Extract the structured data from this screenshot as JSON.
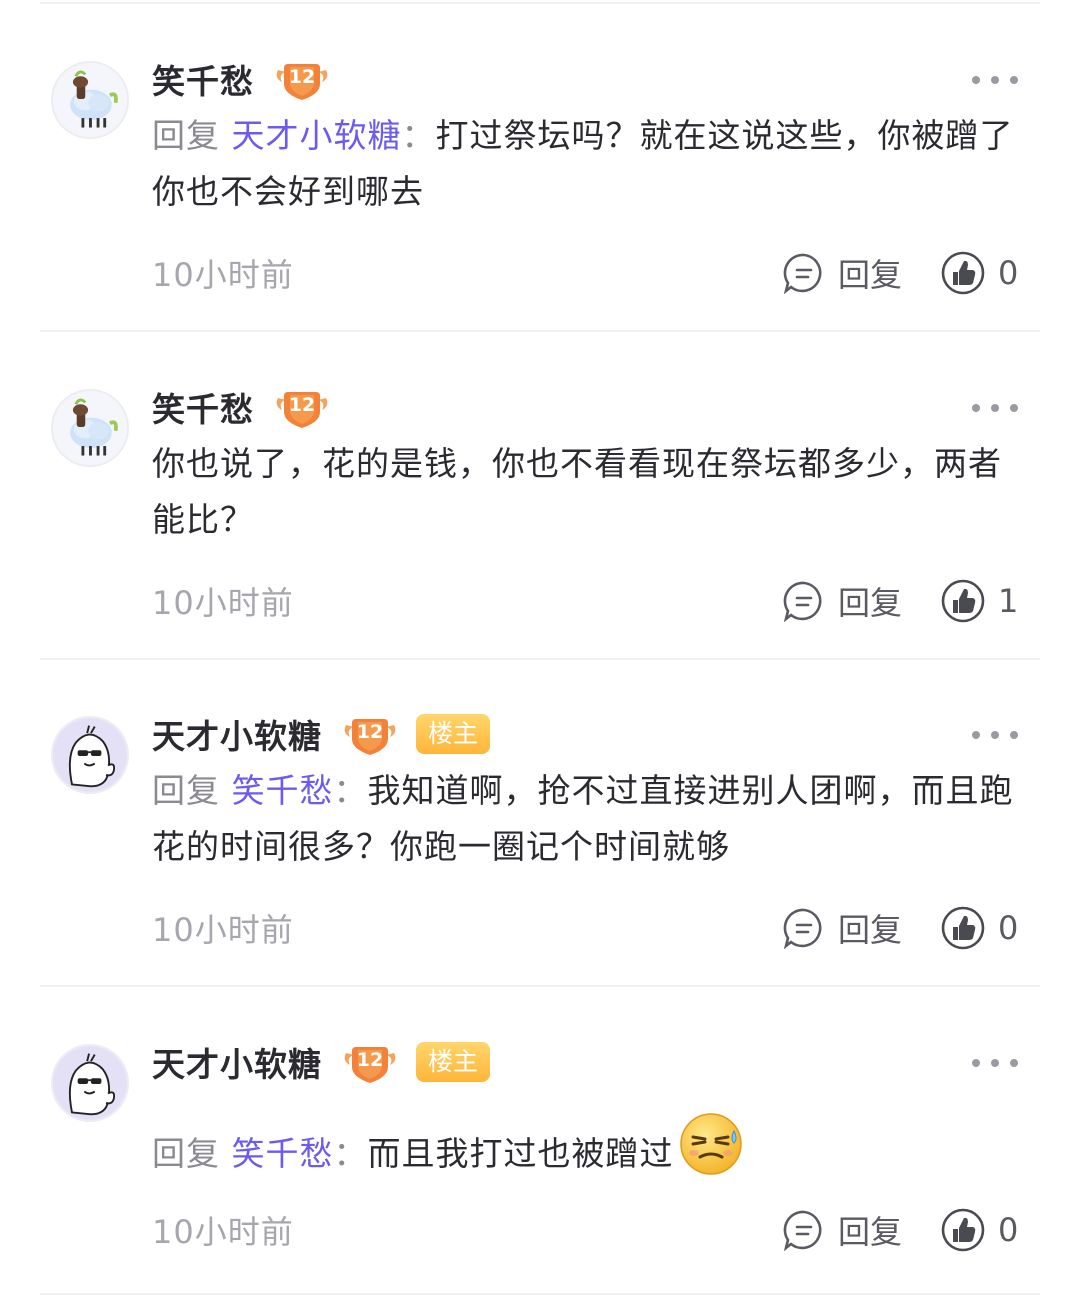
{
  "comments": [
    {
      "username": "笑千愁",
      "level": "12",
      "is_host": false,
      "host_label": "",
      "reply_prefix": "回复",
      "mention": "天才小软糖",
      "colon": "：",
      "text": "打过祭坛吗？就在这说这些，你被蹭了你也不会好到哪去",
      "time": "10小时前",
      "reply_label": "回复",
      "like_count": "0",
      "avatar": "sheep-avatar",
      "emoji": ""
    },
    {
      "username": "笑千愁",
      "level": "12",
      "is_host": false,
      "host_label": "",
      "reply_prefix": "",
      "mention": "",
      "colon": "",
      "text": "你也说了，花的是钱，你也不看看现在祭坛都多少，两者能比？",
      "time": "10小时前",
      "reply_label": "回复",
      "like_count": "1",
      "avatar": "sheep-avatar",
      "emoji": ""
    },
    {
      "username": "天才小软糖",
      "level": "12",
      "is_host": true,
      "host_label": "楼主",
      "reply_prefix": "回复",
      "mention": "笑千愁",
      "colon": "：",
      "text": "我知道啊，抢不过直接进别人团啊，而且跑花的时间很多？你跑一圈记个时间就够",
      "time": "10小时前",
      "reply_label": "回复",
      "like_count": "0",
      "avatar": "ghost-sunglasses-avatar",
      "emoji": ""
    },
    {
      "username": "天才小软糖",
      "level": "12",
      "is_host": true,
      "host_label": "楼主",
      "reply_prefix": "回复",
      "mention": "笑千愁",
      "colon": "：",
      "text": "而且我打过也被蹭过",
      "time": "10小时前",
      "reply_label": "回复",
      "like_count": "0",
      "avatar": "ghost-sunglasses-avatar",
      "emoji": "sweat-smile-emoji"
    }
  ],
  "colors": {
    "accent": "#6c5bf0",
    "host_badge": "#ffb53a",
    "level_badge": "#f2813a"
  }
}
